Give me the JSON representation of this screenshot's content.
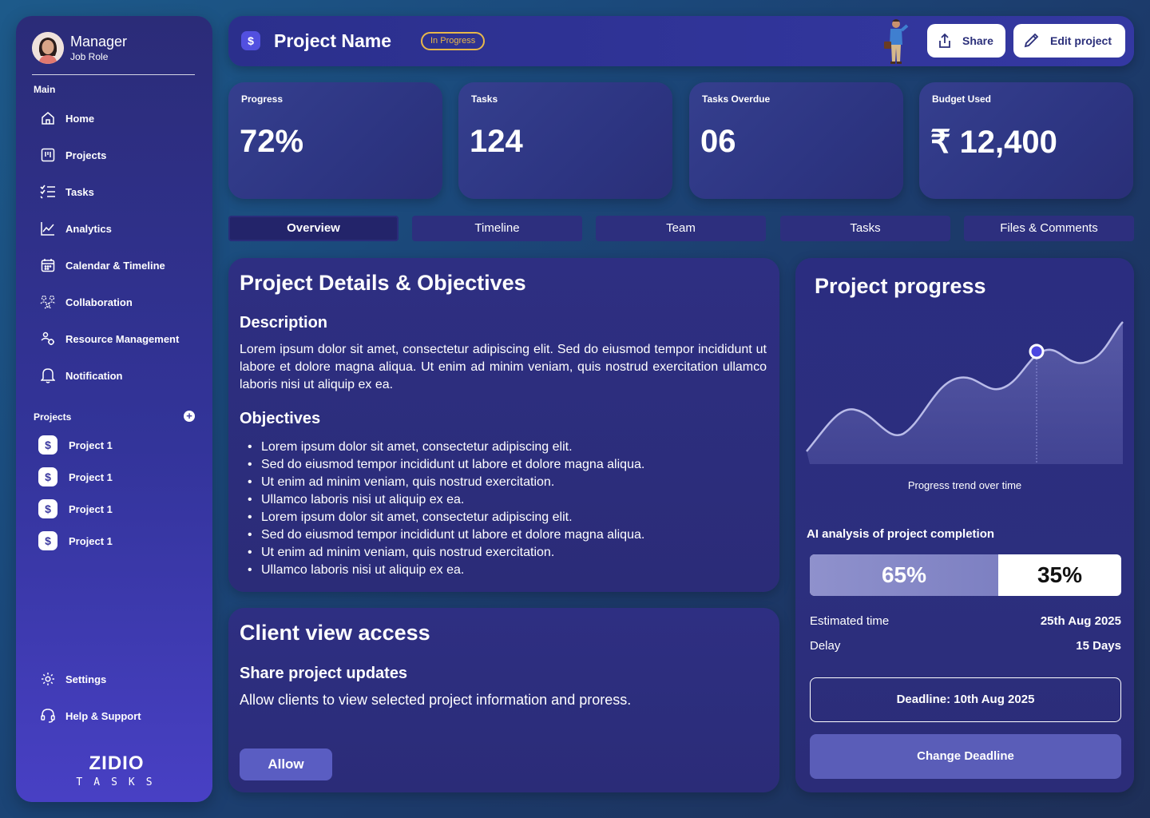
{
  "profile": {
    "name": "Manager",
    "role": "Job Role"
  },
  "sidebar": {
    "main_label": "Main",
    "items": [
      {
        "label": "Home",
        "icon": "home-icon"
      },
      {
        "label": "Projects",
        "icon": "projects-icon"
      },
      {
        "label": "Tasks",
        "icon": "tasks-icon"
      },
      {
        "label": "Analytics",
        "icon": "analytics-icon"
      },
      {
        "label": "Calendar & Timeline",
        "icon": "calendar-icon"
      },
      {
        "label": "Collaboration",
        "icon": "collaboration-icon"
      },
      {
        "label": "Resource Management",
        "icon": "resource-icon"
      },
      {
        "label": "Notification",
        "icon": "bell-icon"
      }
    ],
    "projects_label": "Projects",
    "projects": [
      {
        "label": "Project 1",
        "badge": "$"
      },
      {
        "label": "Project 1",
        "badge": "$"
      },
      {
        "label": "Project 1",
        "badge": "$"
      },
      {
        "label": "Project 1",
        "badge": "$"
      }
    ],
    "settings": "Settings",
    "help": "Help & Support",
    "logo_main": "ZIDIO",
    "logo_sub": "TASKS"
  },
  "header": {
    "badge": "$",
    "title": "Project Name",
    "status": "In Progress",
    "share_label": "Share",
    "edit_label": "Edit project"
  },
  "stats": [
    {
      "label": "Progress",
      "value": "72%"
    },
    {
      "label": "Tasks",
      "value": "124"
    },
    {
      "label": "Tasks Overdue",
      "value": "06"
    },
    {
      "label": "Budget Used",
      "value": "₹ 12,400"
    }
  ],
  "tabs": [
    "Overview",
    "Timeline",
    "Team",
    "Tasks",
    "Files & Comments"
  ],
  "details": {
    "title": "Project Details & Objectives",
    "description_heading": "Description",
    "description": "Lorem ipsum dolor sit amet, consectetur adipiscing elit. Sed do eiusmod tempor incididunt ut labore et dolore magna aliqua. Ut enim ad minim veniam, quis nostrud exercitation ullamco laboris nisi ut aliquip ex ea.",
    "objectives_heading": "Objectives",
    "objectives": [
      "Lorem ipsum dolor sit amet, consectetur adipiscing elit.",
      "Sed do eiusmod tempor incididunt ut labore et dolore magna aliqua.",
      "Ut enim ad minim veniam, quis nostrud exercitation.",
      "Ullamco laboris nisi ut aliquip ex ea.",
      "Lorem ipsum dolor sit amet, consectetur adipiscing elit.",
      "Sed do eiusmod tempor incididunt ut labore et dolore magna aliqua.",
      "Ut enim ad minim veniam, quis nostrud exercitation.",
      "Ullamco laboris nisi ut aliquip ex ea."
    ]
  },
  "client": {
    "title": "Client view access",
    "subtitle": "Share project updates",
    "text": "Allow clients to view selected project information and proress.",
    "allow_label": "Allow"
  },
  "progress_panel": {
    "title": "Project progress",
    "caption": "Progress trend over time",
    "ai_label": "AI analysis of project completion",
    "complete_pct": 65,
    "complete_label": "65%",
    "remaining_label": "35%",
    "estimated_label": "Estimated time",
    "estimated_value": "25th Aug 2025",
    "delay_label": "Delay",
    "delay_value": "15 Days",
    "deadline": "Deadline: 10th Aug 2025",
    "change_label": "Change Deadline"
  },
  "colors": {
    "accent": "#5250e0",
    "status": "#e8b84a",
    "sidebar_top": "#2b2c78",
    "sidebar_bottom": "#4840c4"
  }
}
